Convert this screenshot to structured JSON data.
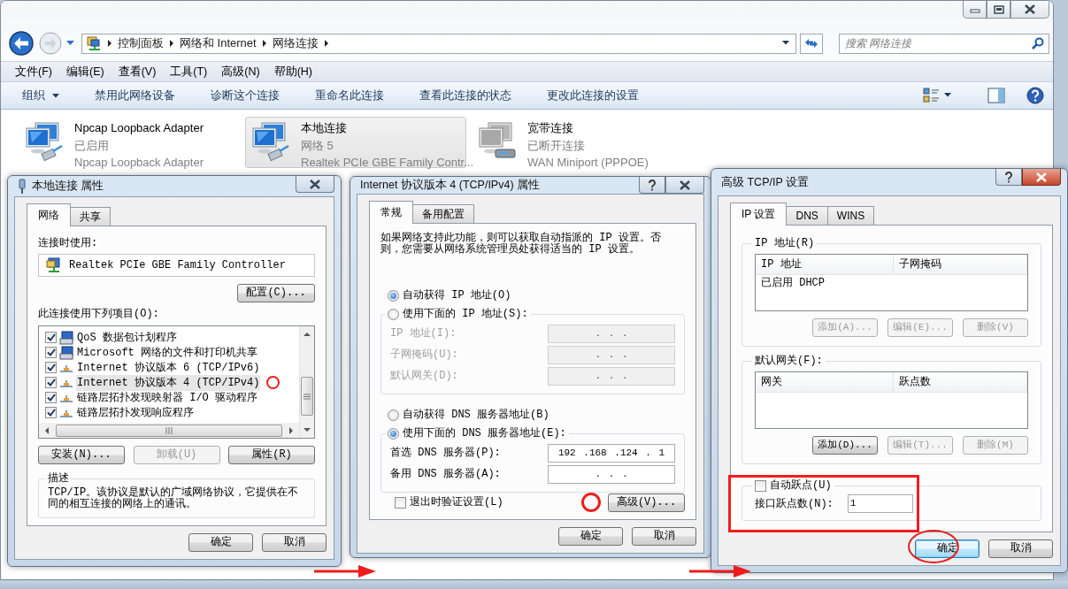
{
  "explorer": {
    "breadcrumb": [
      "控制面板",
      "网络和 Internet",
      "网络连接"
    ],
    "search": {
      "placeholder": "搜索 网络连接"
    },
    "menu": [
      "文件(F)",
      "编辑(E)",
      "查看(V)",
      "工具(T)",
      "高级(N)",
      "帮助(H)"
    ],
    "organize": "组织",
    "commands": [
      "禁用此网络设备",
      "诊断这个连接",
      "重命名此连接",
      "查看此连接的状态",
      "更改此连接的设置"
    ],
    "adapters": [
      {
        "name": "Npcap Loopback Adapter",
        "status": "已启用",
        "device": "Npcap Loopback Adapter",
        "selected": false,
        "kind": "lan"
      },
      {
        "name": "本地连接",
        "status": "网络  5",
        "device": "Realtek PCIe GBE Family Contr...",
        "selected": true,
        "kind": "lan"
      },
      {
        "name": "宽带连接",
        "status": "已断开连接",
        "device": "WAN Miniport (PPPOE)",
        "selected": false,
        "kind": "dialup"
      }
    ]
  },
  "local_properties": {
    "title": "本地连接 属性",
    "tabs": [
      {
        "label": "网络",
        "selected": true
      },
      {
        "label": "共享",
        "selected": false
      }
    ],
    "connect_using_label": "连接时使用:",
    "adapter": "Realtek PCIe GBE Family Controller",
    "configure": "配置(C)...",
    "items_label": "此连接使用下列项目(O):",
    "items": [
      {
        "label": "QoS 数据包计划程序",
        "kind": "service",
        "checked": true,
        "selected": false,
        "circled": false
      },
      {
        "label": "Microsoft 网络的文件和打印机共享",
        "kind": "service",
        "checked": true,
        "selected": false,
        "circled": false
      },
      {
        "label": "Internet 协议版本 6 (TCP/IPv6)",
        "kind": "protocol",
        "checked": true,
        "selected": false,
        "circled": false
      },
      {
        "label": "Internet 协议版本 4 (TCP/IPv4)",
        "kind": "protocol",
        "checked": true,
        "selected": true,
        "circled": true
      },
      {
        "label": "链路层拓扑发现映射器 I/O 驱动程序",
        "kind": "protocol",
        "checked": true,
        "selected": false,
        "circled": false
      },
      {
        "label": "链路层拓扑发现响应程序",
        "kind": "protocol",
        "checked": true,
        "selected": false,
        "circled": false
      }
    ],
    "buttons": [
      {
        "label": "安装(N)...",
        "disabled": false
      },
      {
        "label": "卸载(U)",
        "disabled": true
      },
      {
        "label": "属性(R)",
        "disabled": false
      }
    ],
    "description_label": "描述",
    "description": "TCP/IP。该协议是默认的广域网络协议，它提供在不同的相互连接的网络上的通讯。",
    "footer": [
      {
        "label": "确定",
        "default": false,
        "circled": false
      },
      {
        "label": "取消",
        "default": false,
        "circled": false
      }
    ]
  },
  "ipv4_properties": {
    "title": "Internet 协议版本 4 (TCP/IPv4) 属性",
    "tabs": [
      {
        "label": "常规",
        "selected": true
      },
      {
        "label": "备用配置",
        "selected": false
      }
    ],
    "intro": "如果网络支持此功能，则可以获取自动指派的 IP 设置。否则，您需要从网络系统管理员处获得适当的 IP 设置。",
    "ip_options": [
      {
        "label": "自动获得 IP 地址(O)",
        "selected": true
      },
      {
        "label": "使用下面的 IP 地址(S):",
        "selected": false
      }
    ],
    "ip_fields": [
      {
        "label": "IP 地址(I):",
        "value": ". . .",
        "disabled": true
      },
      {
        "label": "子网掩码(U):",
        "value": ". . .",
        "disabled": true
      },
      {
        "label": "默认网关(D):",
        "value": ". . .",
        "disabled": true
      }
    ],
    "dns_options": [
      {
        "label": "自动获得 DNS 服务器地址(B)",
        "selected": false
      },
      {
        "label": "使用下面的 DNS 服务器地址(E):",
        "selected": true
      }
    ],
    "dns_fields": [
      {
        "label": "首选 DNS 服务器(P):",
        "value": "192 .168 .124 . 1",
        "disabled": false
      },
      {
        "label": "备用 DNS 服务器(A):",
        "value": ". . .",
        "disabled": false
      }
    ],
    "validate": {
      "label": "退出时验证设置(L)",
      "checked": false
    },
    "advanced": {
      "label": "高级(V)...",
      "circled": true
    },
    "footer": [
      {
        "label": "确定",
        "default": false,
        "circled": false
      },
      {
        "label": "取消",
        "default": false,
        "circled": false
      }
    ]
  },
  "advanced_tcpip": {
    "title": "高级 TCP/IP 设置",
    "tabs": [
      {
        "label": "IP 设置",
        "selected": true
      },
      {
        "label": "DNS",
        "selected": false
      },
      {
        "label": "WINS",
        "selected": false
      }
    ],
    "ip_group": {
      "title": "IP 地址(R)",
      "columns": [
        "IP 地址",
        "子网掩码"
      ],
      "rows": [
        [
          "已启用 DHCP"
        ]
      ],
      "buttons": [
        {
          "label": "添加(A)...",
          "disabled": true
        },
        {
          "label": "编辑(E)...",
          "disabled": true
        },
        {
          "label": "删除(V)",
          "disabled": true
        }
      ]
    },
    "gateway_group": {
      "title": "默认网关(F):",
      "columns": [
        "网关",
        "跃点数"
      ],
      "buttons": [
        {
          "label": "添加(D)...",
          "disabled": false
        },
        {
          "label": "编辑(T)...",
          "disabled": true
        },
        {
          "label": "删除(M)",
          "disabled": true
        }
      ]
    },
    "auto_metric": {
      "label": "自动跃点(U)",
      "checked": false,
      "boxed": true
    },
    "metric": {
      "label": "接口跃点数(N):",
      "value": "1"
    },
    "footer": [
      {
        "label": "确定",
        "default": true,
        "circled": true
      },
      {
        "label": "取消",
        "default": false,
        "circled": false
      }
    ]
  }
}
